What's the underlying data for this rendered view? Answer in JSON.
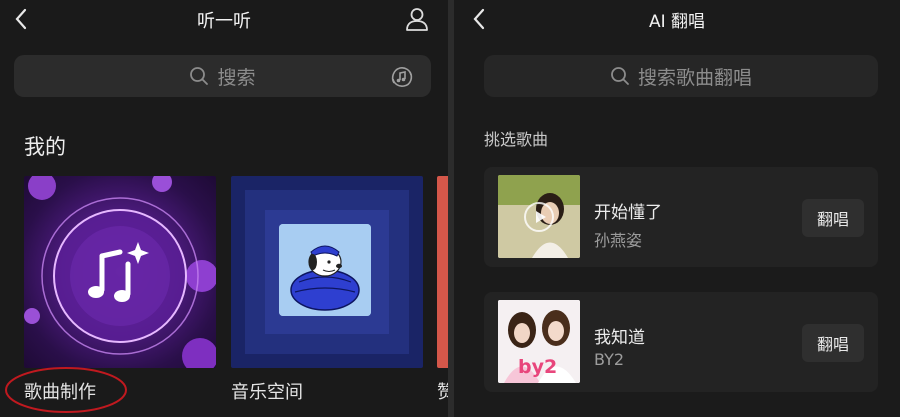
{
  "left": {
    "title": "听一听",
    "search_placeholder": "搜索",
    "section_title": "我的",
    "cards": [
      {
        "label": "歌曲制作"
      },
      {
        "label": "音乐空间"
      },
      {
        "label": "赞"
      }
    ]
  },
  "right": {
    "title": "AI 翻唱",
    "search_placeholder": "搜索歌曲翻唱",
    "section_title": "挑选歌曲",
    "songs": [
      {
        "title": "开始懂了",
        "artist": "孙燕姿",
        "button": "翻唱"
      },
      {
        "title": "我知道",
        "artist": "BY2",
        "button": "翻唱",
        "cover_text": "by2"
      }
    ]
  },
  "colors": {
    "annotation_circle": "#c0191f",
    "accent_purple": "#b04fd6",
    "space_blue": "#1f2c7a"
  },
  "icons": {
    "back": "chevron-left-icon",
    "profile": "user-icon",
    "search": "search-icon",
    "recognize": "music-recognize-icon",
    "note": "music-note-sparkle-icon",
    "play": "play-icon"
  }
}
